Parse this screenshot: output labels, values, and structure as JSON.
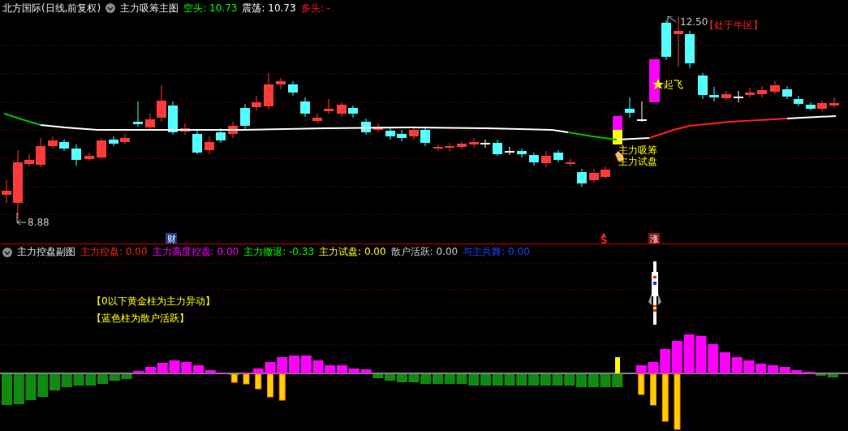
{
  "main_header": {
    "title": "北方国际(日线,前复权)",
    "indicator": "主力吸筹主图",
    "values": [
      {
        "label": "空头:",
        "value": "10.73",
        "color": "#00ff00"
      },
      {
        "label": "震荡:",
        "value": "10.73",
        "color": "#ffffff"
      },
      {
        "label": "多头:",
        "value": "-",
        "color": "#ff2020"
      }
    ]
  },
  "main_chart": {
    "high_label": "12.50",
    "low_label": "8.88",
    "zone_label": "【处于牛区】",
    "takeoff_label": "起飞",
    "signal_labels": [
      "主力吸筹",
      "主力试盘"
    ],
    "markers": [
      {
        "text": "财",
        "kind": "badge",
        "color": "#1c3f8c"
      },
      {
        "text": "S",
        "kind": "plain",
        "color": "#ff2020"
      },
      {
        "text": "涨",
        "kind": "badge",
        "color": "#8c1010"
      }
    ]
  },
  "sub_header": {
    "indicator": "主力控盘副图",
    "values": [
      {
        "label": "主力控盘:",
        "value": "0.00",
        "color": "#ff2020"
      },
      {
        "label": "主力高度控盘:",
        "value": "0.00",
        "color": "#ff00ff"
      },
      {
        "label": "主力撤退:",
        "value": "-0.33",
        "color": "#00ff00"
      },
      {
        "label": "主力试盘:",
        "value": "0.00",
        "color": "#ffff00"
      },
      {
        "label": "散户活跃:",
        "value": "0.00",
        "color": "#c8c8c8"
      },
      {
        "label": "与主共舞:",
        "value": "0.00",
        "color": "#2040ff"
      }
    ]
  },
  "sub_chart": {
    "notes": [
      "【0以下黄金柱为主力异动】",
      "【蓝色柱为散户活跃】"
    ]
  }
}
